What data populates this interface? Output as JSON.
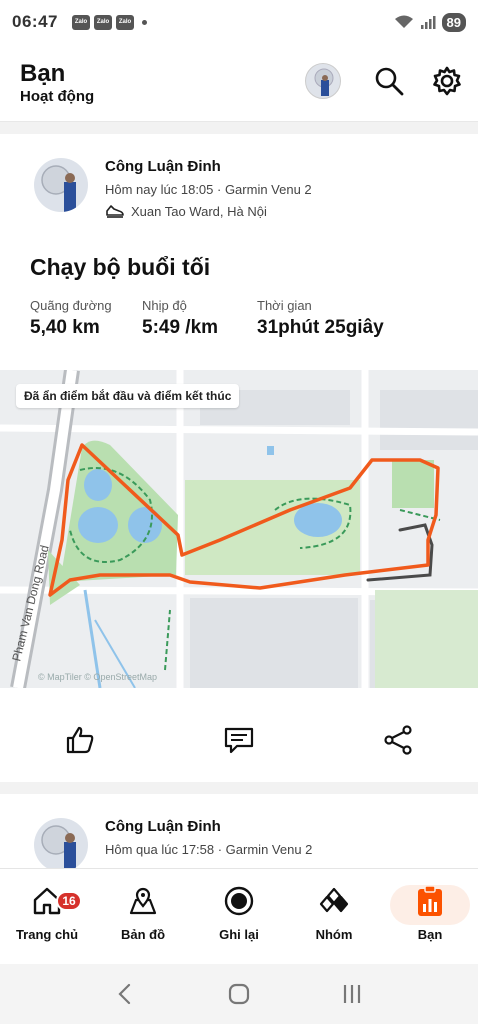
{
  "status_bar": {
    "time": "06:47",
    "notification_badges": [
      "Zalo",
      "Zalo",
      "Zalo"
    ],
    "battery": "89"
  },
  "header": {
    "title": "Bạn",
    "subtitle": "Hoạt động"
  },
  "activity": {
    "athlete_name": "Công Luận Đinh",
    "meta": "Hôm nay lúc 18:05 · Garmin Venu 2",
    "location": "Xuan Tao Ward, Hà Nội",
    "title": "Chạy bộ buổi tối",
    "stats": [
      {
        "label": "Quãng đường",
        "value": "5,40 km"
      },
      {
        "label": "Nhịp độ",
        "value": "5:49 /km"
      },
      {
        "label": "Thời gian",
        "value": "31phút 25giây"
      }
    ],
    "map": {
      "notice": "Đã ẩn điểm bắt đầu và điểm kết thúc",
      "road_label": "Pham Van Dong Road",
      "attribution": "© MapTiler © OpenStreetMap"
    }
  },
  "next_activity": {
    "athlete_name": "Công Luận Đinh",
    "meta": "Hôm qua lúc 17:58 · Garmin Venu 2"
  },
  "bottom_nav": {
    "items": [
      {
        "label": "Trang chủ",
        "badge": "16"
      },
      {
        "label": "Bản đồ"
      },
      {
        "label": "Ghi lại"
      },
      {
        "label": "Nhóm"
      },
      {
        "label": "Bạn"
      }
    ],
    "active_index": 4
  },
  "colors": {
    "accent": "#fc5200",
    "route": "#f05a1c",
    "badge": "#d6312b",
    "park": "#b9dfb0"
  }
}
